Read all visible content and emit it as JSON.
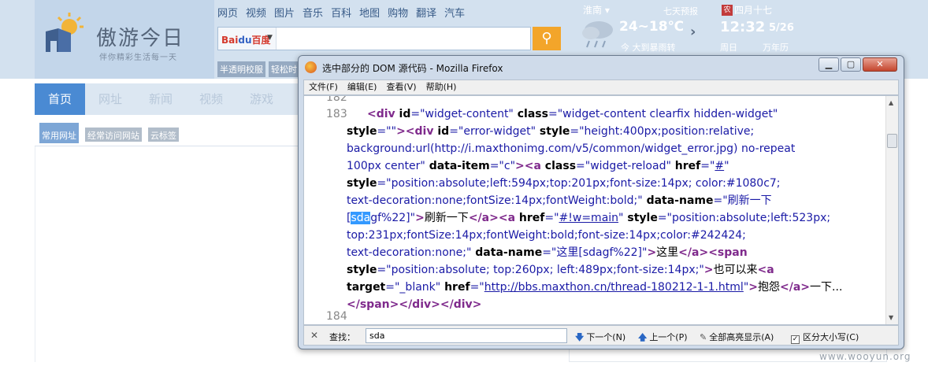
{
  "logo": {
    "text": "傲游今日",
    "slogan": "伴你精彩生活每一天"
  },
  "nav_links": [
    "网页",
    "视频",
    "图片",
    "音乐",
    "百科",
    "地图",
    "购物",
    "翻译",
    "汽车"
  ],
  "search": {
    "engine": "Bai",
    "engine_paw": "du",
    "engine_cn": "百度",
    "value": ""
  },
  "quick_links": [
    "半透明校服",
    "轻松时"
  ],
  "weather": {
    "city": "淮南 ▾",
    "forecast_link": "七天预报",
    "temp": "24~18℃",
    "desc": "今 大到暴雨转"
  },
  "calendar": {
    "badge": "农",
    "lunar": "四月十七",
    "time": "12:32",
    "date": "5/26",
    "weekday": "周日",
    "almanac": "万年历"
  },
  "main_tabs": [
    "首页",
    "网址",
    "新闻",
    "视频",
    "游戏"
  ],
  "sub_tabs": [
    "常用网址",
    "经常访问网站",
    "云标签"
  ],
  "window": {
    "title": "选中部分的 DOM 源代码 - Mozilla Firefox",
    "menu": [
      "文件(F)",
      "编辑(E)",
      "查看(V)",
      "帮助(H)"
    ]
  },
  "source": {
    "line_top": "182",
    "line_main": "183",
    "line_bottom": "184",
    "l1_t1": "<div",
    "l1_a1": " id",
    "l1_v1": "=\"widget-content\"",
    "l1_a2": " class",
    "l1_v2": "=\"widget-content clearfix hidden-widget\"",
    "l2_a1": "style",
    "l2_v1": "=\"\"",
    "l2_t1": "><div",
    "l2_a2": " id",
    "l2_v2": "=\"error-widget\"",
    "l2_a3": " style",
    "l2_v3": "=\"height:400px;position:relative;",
    "l3_v1": "background:url(http://i.maxthonimg.com/v5/common/widget_error.jpg) no-repeat",
    "l4_v1": "100px center\"",
    "l4_a1": " data-item",
    "l4_v2": "=\"c\"",
    "l4_t1": "><a",
    "l4_a2": " class",
    "l4_v3": "=\"widget-reload\"",
    "l4_a3": " href",
    "l4_v4": "=\"",
    "l4_l1": "#",
    "l4_v5": "\"",
    "l5_a1": "style",
    "l5_v1": "=\"position:absolute;left:594px;top:201px;font-size:14px; color:#1080c7;",
    "l6_v1": "text-decoration:none;fontSize:14px;fontWeight:bold;\"",
    "l6_a1": " data-name",
    "l6_v2": "=\"刷新一下",
    "l7_v1": "[",
    "l7_hl": "sda",
    "l7_v2": "gf%22]\"",
    "l7_t1": ">",
    "l7_x1": "刷新一下",
    "l7_t2": "</a><a",
    "l7_a1": " href",
    "l7_v3": "=\"",
    "l7_l1": "#!w=main",
    "l7_v4": "\"",
    "l7_a2": " style",
    "l7_v5": "=\"position:absolute;left:523px;",
    "l8_v1": "top:231px;fontSize:14px;fontWeight:bold;font-size:14px;color:#242424;",
    "l9_v1": "text-decoration:none;\"",
    "l9_a1": " data-name",
    "l9_v2": "=\"这里[sdagf%22]\"",
    "l9_t1": ">",
    "l9_x1": "这里",
    "l9_t2": "</a><span",
    "l10_a1": "style",
    "l10_v1": "=\"position:absolute; top:260px; left:489px;font-size:14px;\"",
    "l10_t1": ">",
    "l10_x1": "也可以来",
    "l10_t2": "<a",
    "l11_a1": "target",
    "l11_v1": "=\"_blank\"",
    "l11_a2": " href",
    "l11_v2": "=\"",
    "l11_l1": "http://bbs.maxthon.cn/thread-180212-1-1.html",
    "l11_v3": "\"",
    "l11_t1": ">",
    "l11_x1": "抱怨",
    "l11_t2": "</a>",
    "l11_x2": "一下...",
    "l12_t1": "</span></div></div>"
  },
  "findbar": {
    "close": "✕",
    "label": "查找：",
    "value": "sda",
    "next": "下一个(N)",
    "prev": "上一个(P)",
    "highlight": "全部高亮显示(A)",
    "match_case": "区分大小写(C)",
    "match_case_checked": "✓"
  },
  "watermark": "www.wooyun.org"
}
